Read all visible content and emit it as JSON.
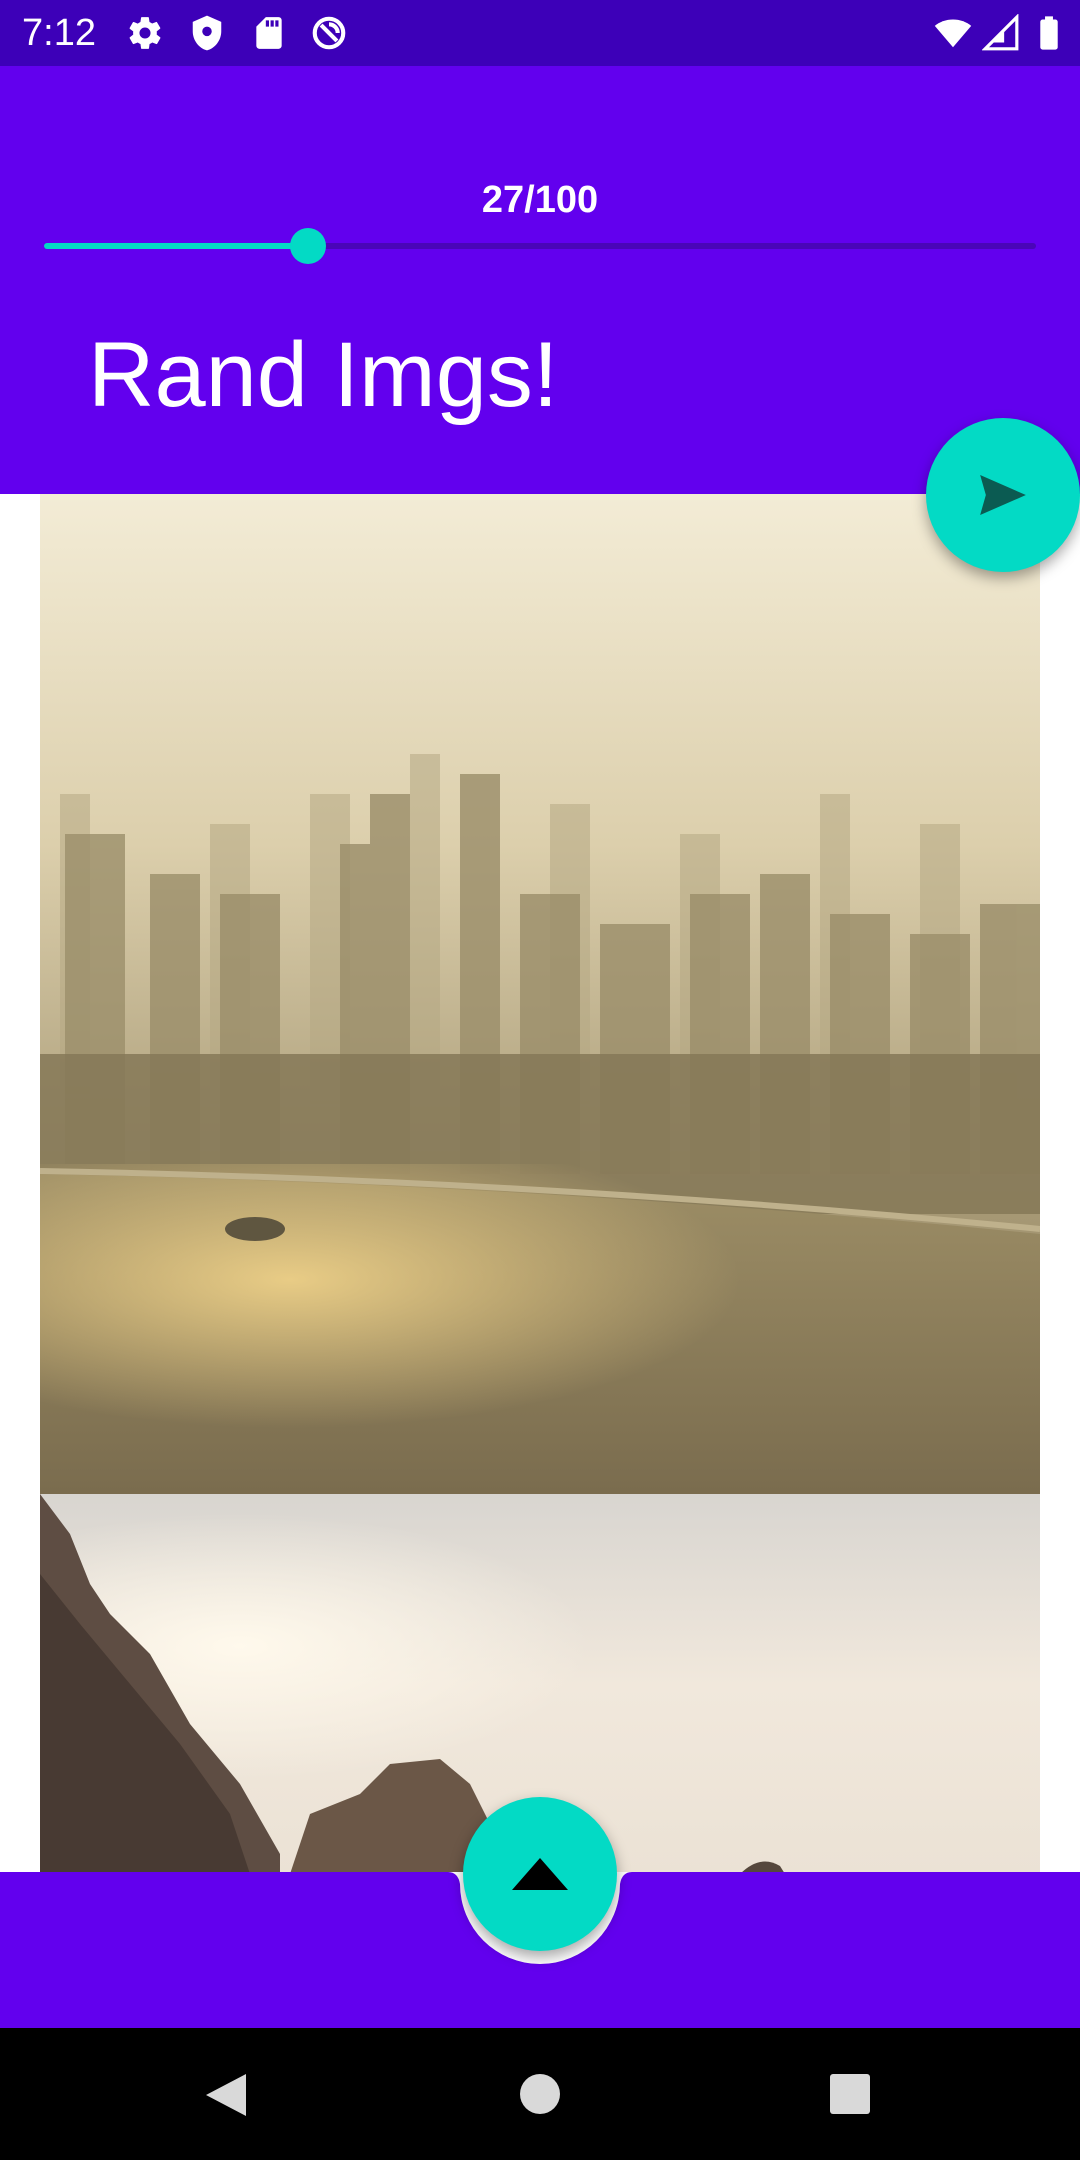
{
  "status_bar": {
    "time": "7:12",
    "left_icons": [
      "gear-icon",
      "shield-icon",
      "sd-card-icon",
      "sync-icon"
    ],
    "right_icons": [
      "wifi-icon",
      "cell-signal-icon",
      "battery-icon"
    ]
  },
  "header": {
    "seek_value": "27/100",
    "seek_progress": 0.27,
    "title": "Rand Imgs!"
  },
  "images": [
    {
      "description": "hazy city skyline over river"
    },
    {
      "description": "rocky coast cliffs"
    }
  ],
  "colors": {
    "primary": "#6200ee",
    "primary_dark": "#3d00b8",
    "accent": "#03dac5"
  },
  "fab_send_icon": "send-icon",
  "fab_up_icon": "triangle-up-icon",
  "nav": {
    "icons": [
      "back-icon",
      "home-icon",
      "recents-icon"
    ]
  }
}
